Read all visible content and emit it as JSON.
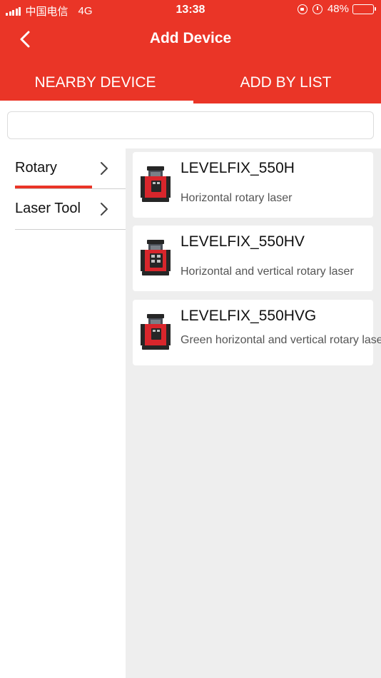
{
  "status_bar": {
    "carrier": "中国电信",
    "network": "4G",
    "time": "13:38",
    "battery_pct": "48%",
    "battery_level": 0.48,
    "icons": [
      "signal-icon",
      "orientation-lock-icon",
      "alarm-icon",
      "battery-icon"
    ]
  },
  "header": {
    "title": "Add Device",
    "back_icon": "chevron-left-icon"
  },
  "tabs": [
    {
      "label": "NEARBY DEVICE",
      "active": true
    },
    {
      "label": "ADD BY LIST",
      "active": false
    }
  ],
  "search": {
    "value": "",
    "placeholder": ""
  },
  "categories": [
    {
      "label": "Rotary",
      "active": true,
      "icon": "chevron-right-icon"
    },
    {
      "label": "Laser Tool",
      "active": false,
      "icon": "chevron-right-icon"
    }
  ],
  "products": [
    {
      "name": "LEVELFIX_550H",
      "description": "Horizontal rotary laser"
    },
    {
      "name": "LEVELFIX_550HV",
      "description": "Horizontal and vertical rotary laser"
    },
    {
      "name": "LEVELFIX_550HVG",
      "description": "Green horizontal and vertical rotary laser"
    }
  ],
  "colors": {
    "accent": "#ea3527",
    "panel_bg": "#eeeeee",
    "product_red": "#d8262c",
    "product_dark": "#262626"
  }
}
